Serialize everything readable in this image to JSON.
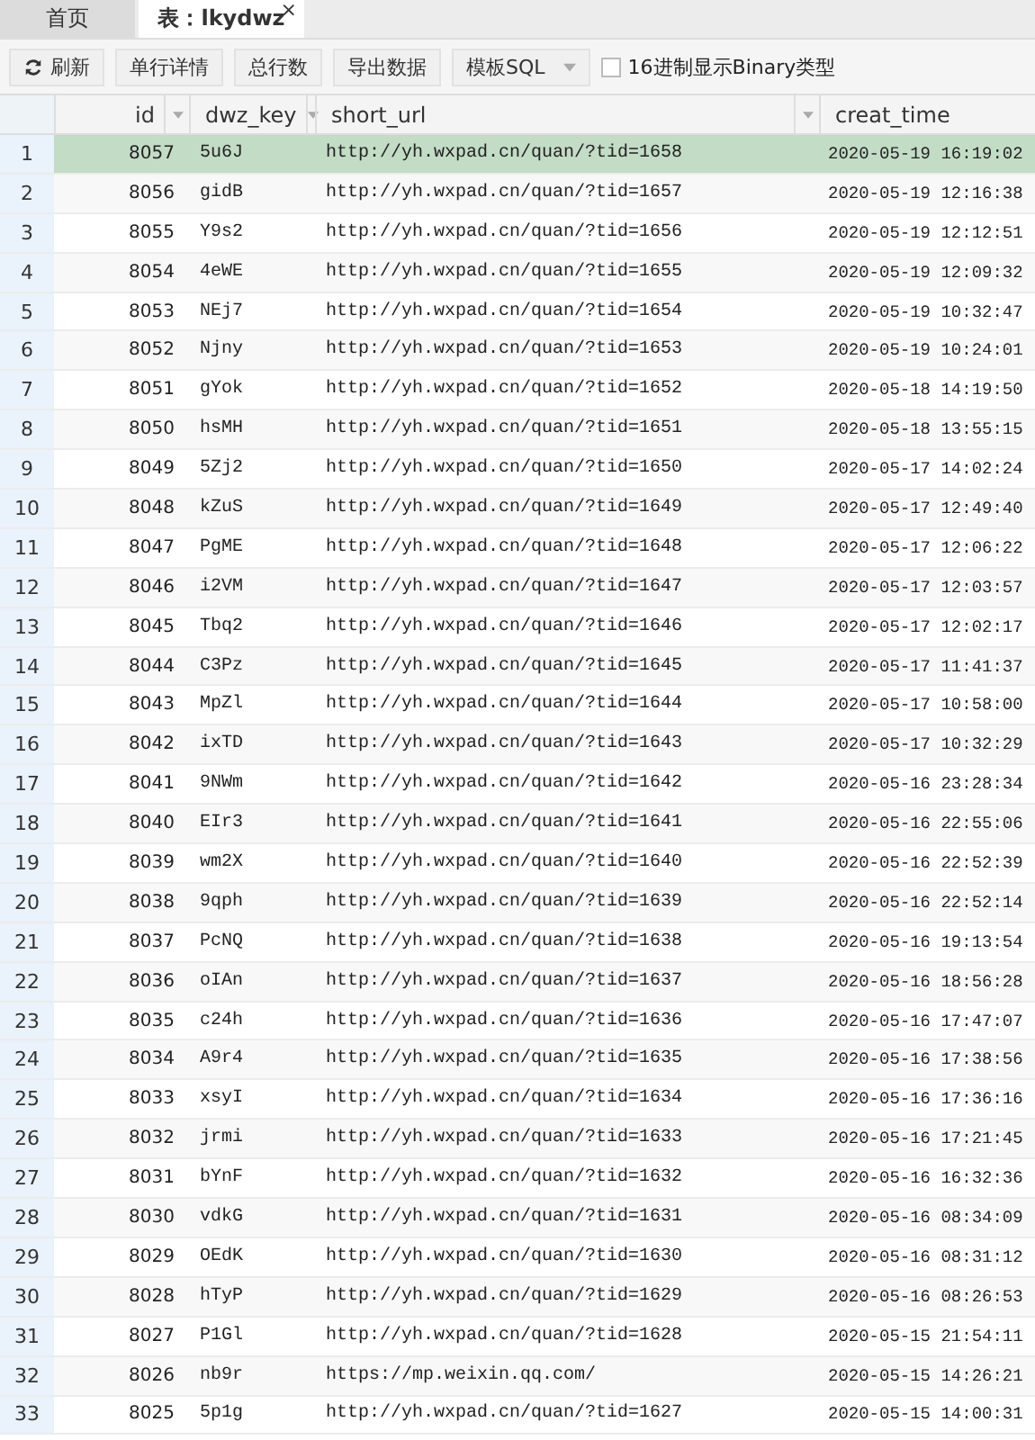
{
  "tabs": [
    {
      "label": "首页",
      "selected": false
    },
    {
      "label": "表：lkydwz",
      "selected": true,
      "close_glyph": "×"
    }
  ],
  "toolbar": {
    "buttons": [
      {
        "label": "刷新",
        "kind": "refresh"
      },
      {
        "label": "单行详情",
        "kind": "plain"
      },
      {
        "label": "总行数",
        "kind": "plain"
      },
      {
        "label": "导出数据",
        "kind": "plain"
      },
      {
        "label": "模板SQL",
        "kind": "dropdown"
      }
    ],
    "checkbox": {
      "label": "16进制显示Binary类型",
      "checked": false
    }
  },
  "table": {
    "columns": [
      {
        "label": "id",
        "filter": true
      },
      {
        "label": "dwz_key",
        "filter": true
      },
      {
        "label": "short_url",
        "filter": true
      },
      {
        "label": "creat_time",
        "filter": false
      }
    ],
    "rows": [
      {
        "n": "1",
        "cells": [
          "8057",
          "5u6J",
          "http://yh.wxpad.cn/quan/?tid=1658",
          "2020-05-19 16:19:02"
        ],
        "selected": true
      },
      {
        "n": "2",
        "cells": [
          "8056",
          "gidB",
          "http://yh.wxpad.cn/quan/?tid=1657",
          "2020-05-19 12:16:38"
        ],
        "selected": false
      },
      {
        "n": "3",
        "cells": [
          "8055",
          "Y9s2",
          "http://yh.wxpad.cn/quan/?tid=1656",
          "2020-05-19 12:12:51"
        ],
        "selected": false
      },
      {
        "n": "4",
        "cells": [
          "8054",
          "4eWE",
          "http://yh.wxpad.cn/quan/?tid=1655",
          "2020-05-19 12:09:32"
        ],
        "selected": false
      },
      {
        "n": "5",
        "cells": [
          "8053",
          "NEj7",
          "http://yh.wxpad.cn/quan/?tid=1654",
          "2020-05-19 10:32:47"
        ],
        "selected": false
      },
      {
        "n": "6",
        "cells": [
          "8052",
          "Njny",
          "http://yh.wxpad.cn/quan/?tid=1653",
          "2020-05-19 10:24:01"
        ],
        "selected": false
      },
      {
        "n": "7",
        "cells": [
          "8051",
          "gYok",
          "http://yh.wxpad.cn/quan/?tid=1652",
          "2020-05-18 14:19:50"
        ],
        "selected": false
      },
      {
        "n": "8",
        "cells": [
          "8050",
          "hsMH",
          "http://yh.wxpad.cn/quan/?tid=1651",
          "2020-05-18 13:55:15"
        ],
        "selected": false
      },
      {
        "n": "9",
        "cells": [
          "8049",
          "5Zj2",
          "http://yh.wxpad.cn/quan/?tid=1650",
          "2020-05-17 14:02:24"
        ],
        "selected": false
      },
      {
        "n": "10",
        "cells": [
          "8048",
          "kZuS",
          "http://yh.wxpad.cn/quan/?tid=1649",
          "2020-05-17 12:49:40"
        ],
        "selected": false
      },
      {
        "n": "11",
        "cells": [
          "8047",
          "PgME",
          "http://yh.wxpad.cn/quan/?tid=1648",
          "2020-05-17 12:06:22"
        ],
        "selected": false
      },
      {
        "n": "12",
        "cells": [
          "8046",
          "i2VM",
          "http://yh.wxpad.cn/quan/?tid=1647",
          "2020-05-17 12:03:57"
        ],
        "selected": false
      },
      {
        "n": "13",
        "cells": [
          "8045",
          "Tbq2",
          "http://yh.wxpad.cn/quan/?tid=1646",
          "2020-05-17 12:02:17"
        ],
        "selected": false
      },
      {
        "n": "14",
        "cells": [
          "8044",
          "C3Pz",
          "http://yh.wxpad.cn/quan/?tid=1645",
          "2020-05-17 11:41:37"
        ],
        "selected": false
      },
      {
        "n": "15",
        "cells": [
          "8043",
          "MpZl",
          "http://yh.wxpad.cn/quan/?tid=1644",
          "2020-05-17 10:58:00"
        ],
        "selected": false
      },
      {
        "n": "16",
        "cells": [
          "8042",
          "ixTD",
          "http://yh.wxpad.cn/quan/?tid=1643",
          "2020-05-17 10:32:29"
        ],
        "selected": false
      },
      {
        "n": "17",
        "cells": [
          "8041",
          "9NWm",
          "http://yh.wxpad.cn/quan/?tid=1642",
          "2020-05-16 23:28:34"
        ],
        "selected": false
      },
      {
        "n": "18",
        "cells": [
          "8040",
          "EIr3",
          "http://yh.wxpad.cn/quan/?tid=1641",
          "2020-05-16 22:55:06"
        ],
        "selected": false
      },
      {
        "n": "19",
        "cells": [
          "8039",
          "wm2X",
          "http://yh.wxpad.cn/quan/?tid=1640",
          "2020-05-16 22:52:39"
        ],
        "selected": false
      },
      {
        "n": "20",
        "cells": [
          "8038",
          "9qph",
          "http://yh.wxpad.cn/quan/?tid=1639",
          "2020-05-16 22:52:14"
        ],
        "selected": false
      },
      {
        "n": "21",
        "cells": [
          "8037",
          "PcNQ",
          "http://yh.wxpad.cn/quan/?tid=1638",
          "2020-05-16 19:13:54"
        ],
        "selected": false
      },
      {
        "n": "22",
        "cells": [
          "8036",
          "oIAn",
          "http://yh.wxpad.cn/quan/?tid=1637",
          "2020-05-16 18:56:28"
        ],
        "selected": false
      },
      {
        "n": "23",
        "cells": [
          "8035",
          "c24h",
          "http://yh.wxpad.cn/quan/?tid=1636",
          "2020-05-16 17:47:07"
        ],
        "selected": false
      },
      {
        "n": "24",
        "cells": [
          "8034",
          "A9r4",
          "http://yh.wxpad.cn/quan/?tid=1635",
          "2020-05-16 17:38:56"
        ],
        "selected": false
      },
      {
        "n": "25",
        "cells": [
          "8033",
          "xsyI",
          "http://yh.wxpad.cn/quan/?tid=1634",
          "2020-05-16 17:36:16"
        ],
        "selected": false
      },
      {
        "n": "26",
        "cells": [
          "8032",
          "jrmi",
          "http://yh.wxpad.cn/quan/?tid=1633",
          "2020-05-16 17:21:45"
        ],
        "selected": false
      },
      {
        "n": "27",
        "cells": [
          "8031",
          "bYnF",
          "http://yh.wxpad.cn/quan/?tid=1632",
          "2020-05-16 16:32:36"
        ],
        "selected": false
      },
      {
        "n": "28",
        "cells": [
          "8030",
          "vdkG",
          "http://yh.wxpad.cn/quan/?tid=1631",
          "2020-05-16 08:34:09"
        ],
        "selected": false
      },
      {
        "n": "29",
        "cells": [
          "8029",
          "OEdK",
          "http://yh.wxpad.cn/quan/?tid=1630",
          "2020-05-16 08:31:12"
        ],
        "selected": false
      },
      {
        "n": "30",
        "cells": [
          "8028",
          "hTyP",
          "http://yh.wxpad.cn/quan/?tid=1629",
          "2020-05-16 08:26:53"
        ],
        "selected": false
      },
      {
        "n": "31",
        "cells": [
          "8027",
          "P1Gl",
          "http://yh.wxpad.cn/quan/?tid=1628",
          "2020-05-15 21:54:11"
        ],
        "selected": false
      },
      {
        "n": "32",
        "cells": [
          "8026",
          "nb9r",
          "https://mp.weixin.qq.com/",
          "2020-05-15 14:26:21"
        ],
        "selected": false
      },
      {
        "n": "33",
        "cells": [
          "8025",
          "5p1g",
          "http://yh.wxpad.cn/quan/?tid=1627",
          "2020-05-15 14:00:31"
        ],
        "selected": false
      }
    ]
  }
}
